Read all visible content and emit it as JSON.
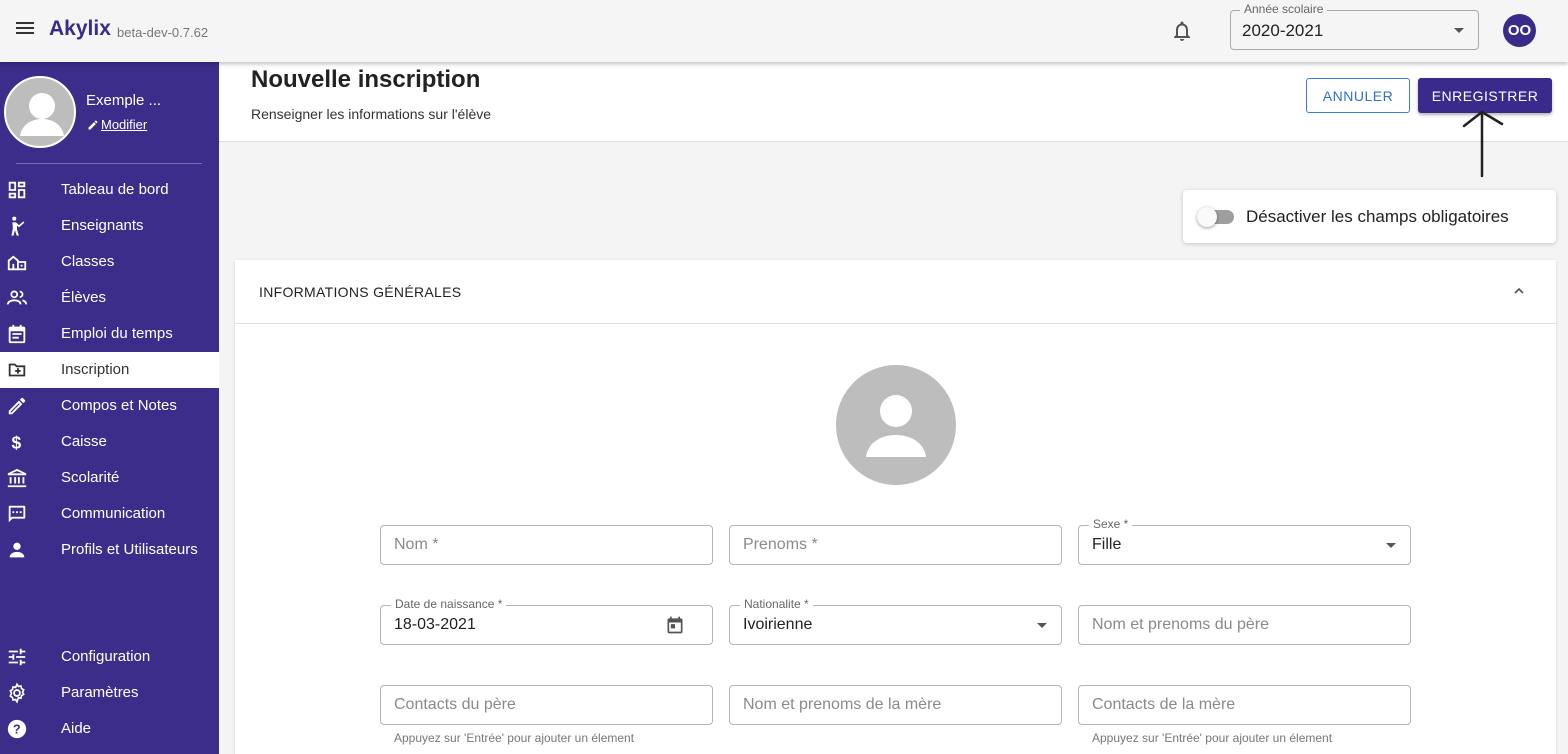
{
  "topbar": {
    "brand": "Akylix",
    "version": "beta-dev-0.7.62",
    "year_label": "Année scolaire",
    "year_value": "2020-2021",
    "user_initials": "OO"
  },
  "sidebar": {
    "profile_name": "Exemple ...",
    "profile_edit": "Modifier",
    "items": [
      {
        "label": "Tableau de bord",
        "icon": "dashboard-icon"
      },
      {
        "label": "Enseignants",
        "icon": "teacher-icon"
      },
      {
        "label": "Classes",
        "icon": "school-icon"
      },
      {
        "label": "Élèves",
        "icon": "people-icon"
      },
      {
        "label": "Emploi du temps",
        "icon": "calendar-icon"
      },
      {
        "label": "Inscription",
        "icon": "folder-plus-icon"
      },
      {
        "label": "Compos et Notes",
        "icon": "pencil-icon"
      },
      {
        "label": "Caisse",
        "icon": "dollar-icon"
      },
      {
        "label": "Scolarité",
        "icon": "bank-icon"
      },
      {
        "label": "Communication",
        "icon": "chat-icon"
      },
      {
        "label": "Profils et Utilisateurs",
        "icon": "person-icon"
      },
      {
        "label": "Configuration",
        "icon": "sliders-icon"
      },
      {
        "label": "Paramètres",
        "icon": "gear-icon"
      },
      {
        "label": "Aide",
        "icon": "help-icon"
      }
    ],
    "active_index": 5
  },
  "header": {
    "title": "Nouvelle inscription",
    "subtitle": "Renseigner les informations sur l'élève",
    "cancel_label": "ANNULER",
    "save_label": "ENREGISTRER"
  },
  "toggle": {
    "label": "Désactiver les champs obligatoires",
    "checked": false
  },
  "section": {
    "title": "INFORMATIONS GÉNÉRALES"
  },
  "form": {
    "nom_placeholder": "Nom *",
    "prenoms_placeholder": "Prenoms *",
    "sexe_label": "Sexe *",
    "sexe_value": "Fille",
    "dob_label": "Date de naissance *",
    "dob_value": "18-03-2021",
    "nationalite_label": "Nationalite *",
    "nationalite_value": "Ivoirienne",
    "pere_nom_placeholder": "Nom et prenoms du père",
    "pere_contacts_placeholder": "Contacts du père",
    "mere_nom_placeholder": "Nom et prenoms de la mère",
    "mere_contacts_placeholder": "Contacts de la mère",
    "hint": "Appuyez sur 'Entrée' pour ajouter un élement"
  },
  "colors": {
    "primary": "#3a2a8c",
    "sidebar_bg": "#3d2d8a",
    "cancel_border": "#3f7bd9"
  }
}
